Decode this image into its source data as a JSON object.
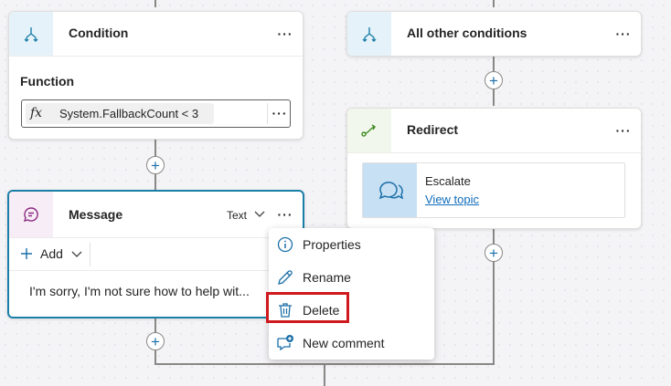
{
  "condition_node": {
    "title": "Condition",
    "function_label": "Function",
    "fx_symbol": "fx",
    "expression": "System.FallbackCount < 3"
  },
  "other_node": {
    "title": "All other conditions"
  },
  "redirect_node": {
    "title": "Redirect",
    "topic_name": "Escalate",
    "view_topic_link": "View topic"
  },
  "message_node": {
    "title": "Message",
    "type_label": "Text",
    "add_label": "Add",
    "message_text": "I'm sorry, I'm not sure how to help wit..."
  },
  "context_menu": {
    "items": [
      {
        "label": "Properties",
        "icon": "info-icon"
      },
      {
        "label": "Rename",
        "icon": "pencil-icon"
      },
      {
        "label": "Delete",
        "icon": "trash-icon"
      },
      {
        "label": "New comment",
        "icon": "comment-add-icon"
      }
    ]
  },
  "colors": {
    "accent": "#1b7fa8",
    "highlight_border": "#d0181f",
    "link": "#0f6cbd",
    "condition_icon_bg": "#e6f2f9",
    "redirect_icon_bg": "#f1f7ec",
    "message_icon_bg": "#f7edf6"
  },
  "more_glyph": "···",
  "plus_glyph": "+"
}
